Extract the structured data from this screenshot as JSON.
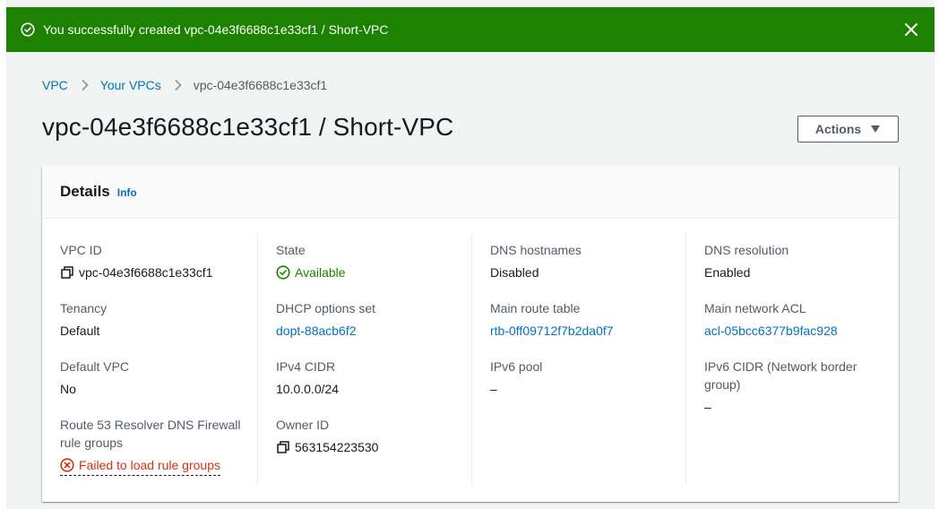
{
  "flash": {
    "message": "You successfully created vpc-04e3f6688c1e33cf1 / Short-VPC",
    "color": "#1d8102"
  },
  "breadcrumb": {
    "items": [
      "VPC",
      "Your VPCs"
    ],
    "current": "vpc-04e3f6688c1e33cf1"
  },
  "page": {
    "title": "vpc-04e3f6688c1e33cf1 / Short-VPC",
    "actions_label": "Actions"
  },
  "details": {
    "title": "Details",
    "info_label": "Info",
    "fields": {
      "vpc_id": {
        "label": "VPC ID",
        "value": "vpc-04e3f6688c1e33cf1",
        "icon": "copy-icon"
      },
      "tenancy": {
        "label": "Tenancy",
        "value": "Default"
      },
      "default_vpc": {
        "label": "Default VPC",
        "value": "No"
      },
      "route53": {
        "label": "Route 53 Resolver DNS Firewall rule groups",
        "value": "Failed to load rule groups",
        "icon": "error-icon"
      },
      "state": {
        "label": "State",
        "value": "Available",
        "icon": "status-success-icon"
      },
      "dhcp": {
        "label": "DHCP options set",
        "value": "dopt-88acb6f2"
      },
      "ipv4_cidr": {
        "label": "IPv4 CIDR",
        "value": "10.0.0.0/24"
      },
      "owner_id": {
        "label": "Owner ID",
        "value": "563154223530",
        "icon": "copy-icon"
      },
      "dns_hostnames": {
        "label": "DNS hostnames",
        "value": "Disabled"
      },
      "main_route_table": {
        "label": "Main route table",
        "value": "rtb-0ff09712f7b2da0f7"
      },
      "ipv6_pool": {
        "label": "IPv6 pool",
        "value": "–"
      },
      "dns_resolution": {
        "label": "DNS resolution",
        "value": "Enabled"
      },
      "main_network_acl": {
        "label": "Main network ACL",
        "value": "acl-05bcc6377b9fac928"
      },
      "ipv6_cidr": {
        "label": "IPv6 CIDR (Network border group)",
        "value": "–"
      }
    }
  },
  "colors": {
    "link": "#0073bb",
    "success": "#1d8102",
    "error": "#d13212",
    "label": "#545b64"
  }
}
